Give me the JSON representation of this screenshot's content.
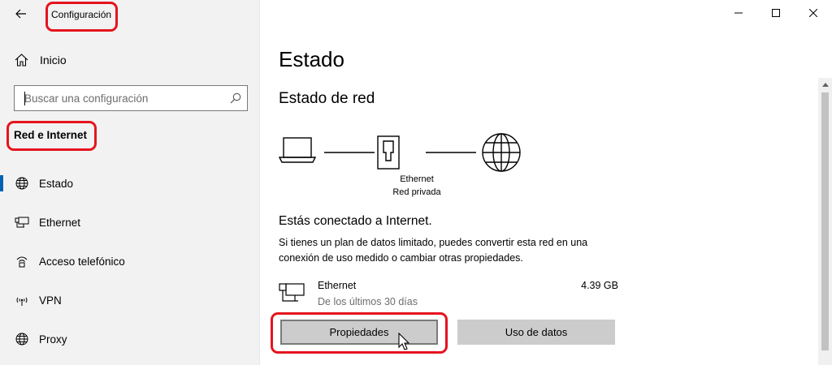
{
  "window": {
    "app_title": "Configuración"
  },
  "sidebar": {
    "home_label": "Inicio",
    "search_placeholder": "Buscar una configuración",
    "section_title": "Red e Internet",
    "items": [
      {
        "label": "Estado",
        "icon": "globe-icon",
        "active": true
      },
      {
        "label": "Ethernet",
        "icon": "ethernet-icon",
        "active": false
      },
      {
        "label": "Acceso telefónico",
        "icon": "dialup-icon",
        "active": false
      },
      {
        "label": "VPN",
        "icon": "vpn-icon",
        "active": false
      },
      {
        "label": "Proxy",
        "icon": "globe-icon",
        "active": false
      }
    ]
  },
  "main": {
    "title": "Estado",
    "subtitle": "Estado de red",
    "diagram": {
      "adapter_name": "Ethernet",
      "network_type": "Red privada"
    },
    "connected_text": "Estás conectado a Internet.",
    "description": "Si tienes un plan de datos limitado, puedes convertir esta red en una conexión de uso medido o cambiar otras propiedades.",
    "usage": {
      "name": "Ethernet",
      "period": "De los últimos 30 días",
      "amount": "4.39 GB"
    },
    "buttons": {
      "properties": "Propiedades",
      "data_usage": "Uso de datos"
    }
  },
  "colors": {
    "accent": "#0063b1",
    "callout": "#e5141e",
    "sidebar_bg": "#f2f2f2",
    "button_bg": "#cccccc"
  }
}
